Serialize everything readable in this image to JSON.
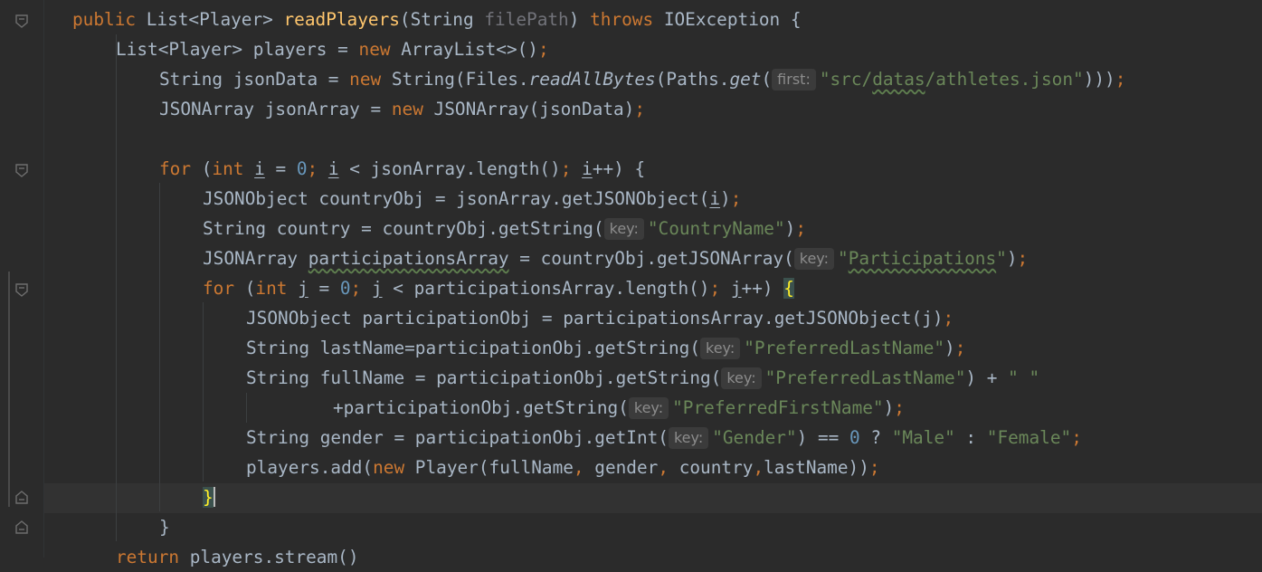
{
  "editor": {
    "hints": {
      "first": "first:",
      "key": "key:"
    },
    "lines": {
      "l1": {
        "public": "public",
        "type": " List<Player> ",
        "method": "readPlayers",
        "open": "(String ",
        "param": "filePath",
        "close": ") ",
        "throws": "throws",
        "exc": " IOException {"
      },
      "l2": {
        "pre": "List<Player> players = ",
        "new": "new",
        "post": " ArrayList<>()",
        "semi": ";"
      },
      "l3": {
        "pre": "String jsonData = ",
        "new": "new",
        "mid1": " String(Files.",
        "read": "readAllBytes",
        "mid2": "(Paths.",
        "get": "get",
        "open": "(",
        "str_q1": "\"src/",
        "str_datas": "datas",
        "str_rest": "/athletes.json\"",
        "close": ")))",
        "semi": ";"
      },
      "l4": {
        "pre": "JSONArray jsonArray = ",
        "new": "new",
        "post": " JSONArray(jsonData)",
        "semi": ";"
      },
      "l6": {
        "for": "for",
        "p1": " (",
        "int": "int",
        "sp": " ",
        "i1": "i",
        "eq": " = ",
        "zero": "0",
        "semi1": ";",
        "sp2": " ",
        "i2": "i",
        "mid": " < jsonArray.length()",
        "semi2": ";",
        "sp3": " ",
        "i3": "i",
        "end": "++) {"
      },
      "l7": {
        "pre": "JSONObject countryObj = jsonArray.getJSONObject(",
        "i": "i",
        "close": ")",
        "semi": ";"
      },
      "l8": {
        "pre": "String country = countryObj.getString(",
        "str": "\"CountryName\"",
        "close": ")",
        "semi": ";"
      },
      "l9": {
        "pre": "JSONArray ",
        "var": "participationsArray",
        "mid": " = countryObj.getJSONArray(",
        "q1": "\"",
        "str": "Participations",
        "q2": "\"",
        "close": ")",
        "semi": ";"
      },
      "l10": {
        "for": "for",
        "p1": " (",
        "int": "int",
        "sp": " ",
        "j1": "j",
        "eq": " = ",
        "zero": "0",
        "semi1": ";",
        "sp2": " ",
        "j2": "j",
        "mid": " < participationsArray.length()",
        "semi2": ";",
        "sp3": " ",
        "j3": "j",
        "end": "++) ",
        "brace": "{"
      },
      "l11": {
        "pre": "JSONObject participationObj = participationsArray.getJSONObject(j)",
        "semi": ";"
      },
      "l12": {
        "pre": "String lastName=participationObj.getString(",
        "str": "\"PreferredLastName\"",
        "close": ")",
        "semi": ";"
      },
      "l13": {
        "pre": "String fullName = participationObj.getString(",
        "str": "\"PreferredLastName\"",
        "close": ") + ",
        "str2": "\" \""
      },
      "l14": {
        "pre": "+participationObj.getString(",
        "str": "\"PreferredFirstName\"",
        "close": ")",
        "semi": ";"
      },
      "l15": {
        "pre": "String gender = participationObj.getInt(",
        "str": "\"Gender\"",
        "mid": ") == ",
        "zero": "0",
        "q": " ? ",
        "male": "\"Male\"",
        "colon": " : ",
        "female": "\"Female\"",
        "semi": ";"
      },
      "l16": {
        "pre": "players.add(",
        "new": "new",
        "a": " Player(fullName",
        "c1": ",",
        "b": " gender",
        "c2": ",",
        "c": " country",
        "c3": ",",
        "d": "lastName))",
        "semi": ";"
      },
      "l17": {
        "brace": "}"
      },
      "l18": {
        "brace": "}"
      },
      "l19": {
        "return": "return",
        "post": " players.stream()"
      }
    }
  },
  "colors": {
    "background": "#2b2b2b",
    "keyword": "#cc7832",
    "method": "#ffc66d",
    "string": "#6a8759",
    "number": "#6897bb",
    "text": "#a9b7c6"
  }
}
